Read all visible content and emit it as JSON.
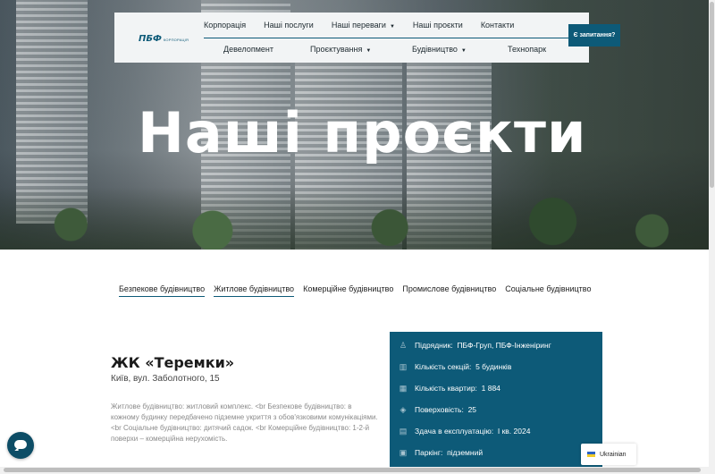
{
  "header": {
    "logo_main": "ПБФ",
    "logo_sub": "КОРПОРАЦІЯ",
    "nav_top": [
      "Корпорація",
      "Наші послуги",
      "Наші переваги",
      "Наші проєкти",
      "Контакти"
    ],
    "nav_bottom": [
      "Девелопмент",
      "Проєктування",
      "Будівництво",
      "Технопарк"
    ],
    "request_button": "Є запитання?"
  },
  "hero": {
    "title": "Наші проєкти"
  },
  "tabs": [
    "Безпекове будівництво",
    "Житлове будівництво",
    "Комерційне будівництво",
    "Промислове будівництво",
    "Соціальне будівництво"
  ],
  "project": {
    "title": "ЖК «Теремки»",
    "address": "Київ, вул. Заболотного, 15",
    "description": "Житлове будівництво: житловий комплекс. <br Безпекове будівництво: в кожному будинку передбачено підземне укриття з обов'язковими комунікаціями. <br Соціальне будівництво: дитячий садок. <br Комерційне будівництво: 1-2-й поверхи – комерційна нерухомість."
  },
  "info": {
    "rows": [
      {
        "label": "Підрядник:",
        "value": "ПБФ-Груп, ПБФ-Інженіринг",
        "icon": "contractor-icon"
      },
      {
        "label": "Кількість секцій:",
        "value": "5 будинків",
        "icon": "buildings-icon"
      },
      {
        "label": "Кількість квартир:",
        "value": "1 884",
        "icon": "floorplan-icon"
      },
      {
        "label": "Поверховість:",
        "value": "25",
        "icon": "floors-icon"
      },
      {
        "label": "Здача в експлуатацію:",
        "value": "І кв. 2024",
        "icon": "calendar-icon"
      },
      {
        "label": "Паркінг:",
        "value": "підземний",
        "icon": "parking-icon"
      }
    ]
  },
  "language": {
    "label": "Ukrainian"
  },
  "colors": {
    "brand": "#0d5a78",
    "tab_underline": "#0d5a78"
  }
}
